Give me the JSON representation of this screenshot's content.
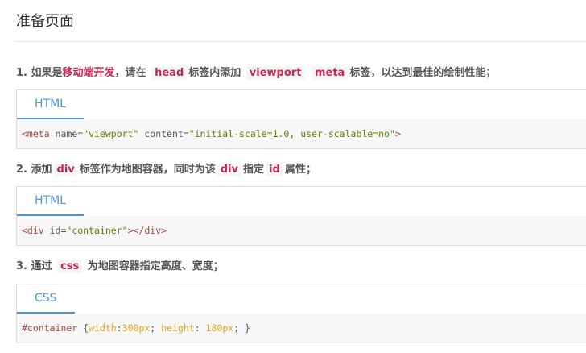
{
  "page": {
    "title": "准备页面"
  },
  "steps": [
    {
      "num": "1.",
      "t1": "如果是",
      "highlight": "移动端开发",
      "t2": "，请在",
      "kw1": "head",
      "t3": "标签内添加",
      "kw2": "viewport",
      "kw3": "meta",
      "t4": "标签，以达到最佳的绘制性能；"
    },
    {
      "num": "2.",
      "t1": "添加",
      "kw1": "div",
      "t2": "标签作为地图容器，同时为该",
      "kw2": "div",
      "t3": "指定",
      "kw3": "id",
      "t4": "属性；"
    },
    {
      "num": "3.",
      "t1": "通过",
      "kw1": "css",
      "t2": "为地图容器指定高度、宽度；"
    }
  ],
  "code_blocks": [
    {
      "tab": "HTML",
      "tokens": {
        "open": "<meta",
        "attr1": " name=",
        "val1": "\"viewport\"",
        "attr2": " content=",
        "val2": "\"initial-scale=1.0, user-scalable=no\"",
        "close": ">"
      }
    },
    {
      "tab": "HTML",
      "tokens": {
        "open": "<div",
        "attr1": " id=",
        "val1": "\"container\"",
        "close": "></div>"
      }
    },
    {
      "tab": "CSS",
      "tokens": {
        "selector": "#container",
        "brace_open": " {",
        "prop1": "width",
        "colon1": ":",
        "val1": "300px",
        "semi1": "; ",
        "prop2": "height",
        "colon2": ": ",
        "val2": "180px",
        "end": "; }"
      }
    }
  ]
}
